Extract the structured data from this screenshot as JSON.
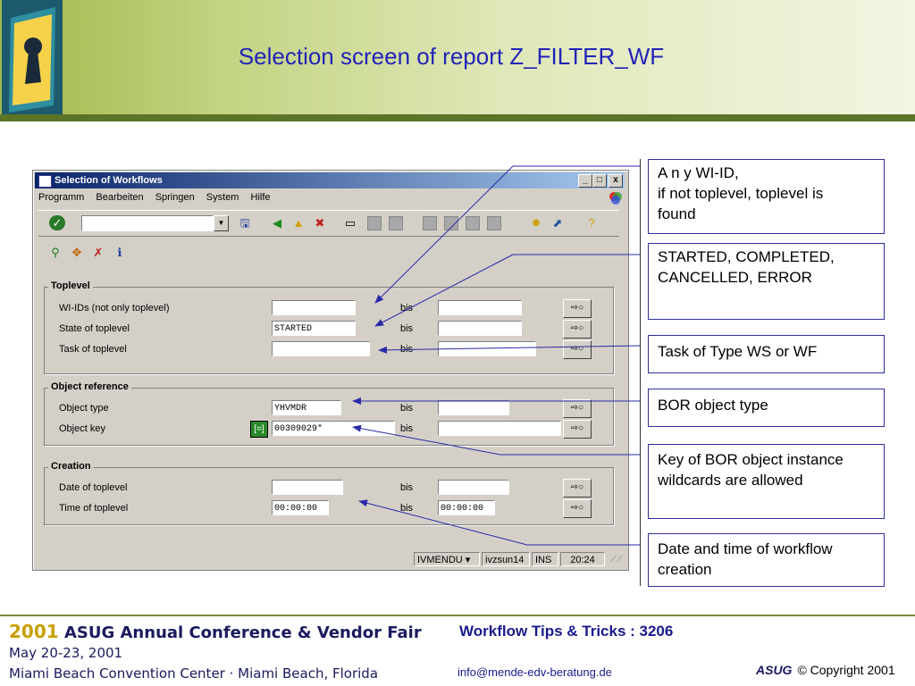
{
  "slide": {
    "title": "Selection screen of report Z_FILTER_WF"
  },
  "window": {
    "title": "Selection of Workflows",
    "buttons": {
      "minimize": "_",
      "maximize": "□",
      "close": "x"
    },
    "menu": [
      "Programm",
      "Bearbeiten",
      "Springen",
      "System",
      "Hilfe"
    ]
  },
  "groups": {
    "toplevel": {
      "title": "Toplevel",
      "rows": [
        {
          "label": "WI-IDs (not only toplevel)",
          "from": "",
          "bis": "bis",
          "to": ""
        },
        {
          "label": "State of toplevel",
          "from": "STARTED",
          "bis": "bis",
          "to": ""
        },
        {
          "label": "Task of toplevel",
          "from": "",
          "bis": "bis",
          "to": ""
        }
      ]
    },
    "objref": {
      "title": "Object reference",
      "rows": [
        {
          "label": "Object type",
          "from": "YHVMDR",
          "bis": "bis",
          "to": ""
        },
        {
          "label": "Object key",
          "from": "00309029*",
          "bis": "bis",
          "to": ""
        }
      ]
    },
    "creation": {
      "title": "Creation",
      "rows": [
        {
          "label": "Date of toplevel",
          "from": "",
          "bis": "bis",
          "to": ""
        },
        {
          "label": "Time of toplevel",
          "from": "00:00:00",
          "bis": "bis",
          "to": "00:00:00"
        }
      ]
    }
  },
  "statusbar": {
    "system": "IVMENDU",
    "server": "ivzsun14",
    "mode": "INS",
    "time": "20:24"
  },
  "callouts": [
    {
      "line1": "A n y  WI-ID,",
      "line2": "if not toplevel, toplevel is",
      "line3": "found"
    },
    {
      "line1": "STARTED, COMPLETED,",
      "line2": "CANCELLED, ERROR"
    },
    {
      "line1": "Task of Type WS or WF"
    },
    {
      "line1": "BOR object type"
    },
    {
      "line1": "Key of BOR object instance",
      "line2": "wildcards are allowed"
    },
    {
      "line1": "Date and time of workflow",
      "line2": "creation"
    }
  ],
  "footer": {
    "year": "2001",
    "conference": "ASUG Annual Conference & Vendor Fair",
    "dates": "May 20-23, 2001",
    "venue": "Miami Beach Convention Center · Miami Beach, Florida",
    "tips": "Workflow Tips & Tricks : 3206",
    "email": "info@mende-edv-beratung.de",
    "asug": "ASUG",
    "copyright": "© Copyright 2001"
  },
  "colors": {
    "title": "#2323b8",
    "sap_titlebar": "#0a246a",
    "window_bg": "#d4d0c8",
    "callout_border": "#3030a0"
  }
}
